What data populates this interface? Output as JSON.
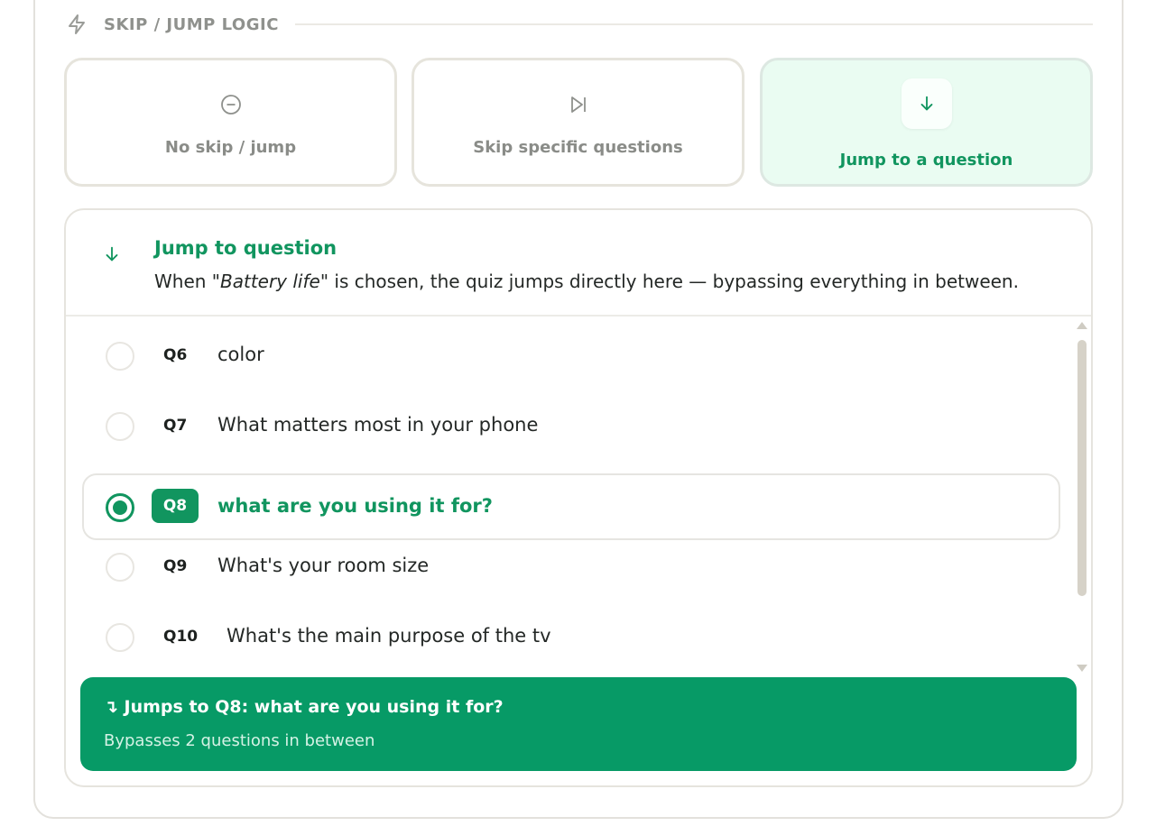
{
  "section": {
    "title": "SKIP / JUMP LOGIC",
    "icon": "lightning-icon"
  },
  "options": [
    {
      "label": "No skip / jump",
      "icon": "minus-circle-icon",
      "selected": false
    },
    {
      "label": "Skip specific questions",
      "icon": "skip-forward-icon",
      "selected": false
    },
    {
      "label": "Jump to a question",
      "icon": "arrow-down-icon",
      "selected": true
    }
  ],
  "panel": {
    "title": "Jump to question",
    "desc_prefix": "When ",
    "desc_choice": "\"Battery life\"",
    "desc_suffix": " is chosen, the quiz jumps directly here — bypassing everything in between."
  },
  "questions": [
    {
      "num": "Q6",
      "text": "color",
      "selected": false
    },
    {
      "num": "Q7",
      "text": "What matters most in your phone",
      "selected": false
    },
    {
      "num": "Q8",
      "text": "what are you using it for?",
      "selected": true
    },
    {
      "num": "Q9",
      "text": "What's your room size",
      "selected": false
    },
    {
      "num": "Q10",
      "text": "What's the main purpose of the tv",
      "selected": false
    }
  ],
  "result": {
    "title": "↴ Jumps to Q8: what are you using it for?",
    "subtitle": "Bypasses 2 questions in between"
  },
  "colors": {
    "accent": "#11955f",
    "result_bg": "#079a66",
    "selected_bg": "#eafcf2"
  }
}
